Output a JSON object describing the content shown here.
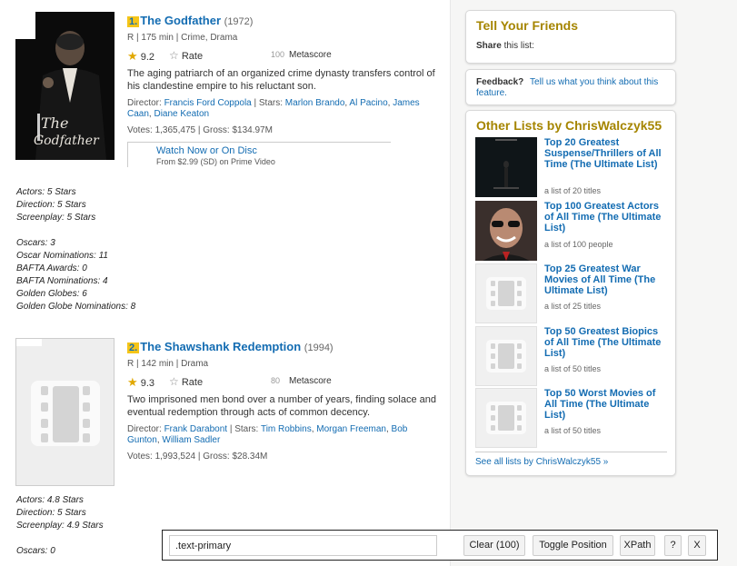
{
  "items": [
    {
      "rank": "1.",
      "title": "The Godfather",
      "year": "(1972)",
      "meta": "R | 175 min | Crime, Drama",
      "rating": "9.2",
      "rate_label": "Rate",
      "metascore": "100",
      "metascore_label": "Metascore",
      "description": "The aging patriarch of an organized crime dynasty transfers control of his clandestine empire to his reluctant son.",
      "director_label": "Director:",
      "director": "Francis Ford Coppola",
      "stars_label": "| Stars:",
      "stars": [
        "Marlon Brando",
        "Al Pacino",
        "James Caan",
        "Diane Keaton"
      ],
      "votes": "Votes: 1,365,475 | Gross: $134.97M",
      "watch_link": "Watch Now or On Disc",
      "watch_sub": "From $2.99 (SD) on Prime Video",
      "notes": [
        "Actors: 5 Stars",
        "Direction: 5 Stars",
        "Screenplay: 5 Stars",
        "",
        "Oscars: 3",
        "Oscar Nominations: 11",
        "BAFTA Awards: 0",
        "BAFTA Nominations: 4",
        "Golden Globes: 6",
        "Golden Globe Nominations: 8"
      ]
    },
    {
      "rank": "2.",
      "title": "The Shawshank Redemption",
      "year": "(1994)",
      "meta": "R | 142 min | Drama",
      "rating": "9.3",
      "rate_label": "Rate",
      "metascore": "80",
      "metascore_label": "Metascore",
      "description": "Two imprisoned men bond over a number of years, finding solace and eventual redemption through acts of common decency.",
      "director_label": "Director:",
      "director": "Frank Darabont",
      "stars_label": "| Stars:",
      "stars": [
        "Tim Robbins",
        "Morgan Freeman",
        "Bob Gunton",
        "William Sadler"
      ],
      "votes": "Votes: 1,993,524 | Gross: $28.34M",
      "notes": [
        "Actors: 4.8 Stars",
        "Direction: 5 Stars",
        "Screenplay: 4.9 Stars",
        "",
        "Oscars: 0"
      ]
    }
  ],
  "sidebar": {
    "friends": {
      "title": "Tell Your Friends",
      "share_bold": "Share",
      "share_rest": " this list:"
    },
    "feedback": {
      "bold": "Feedback?",
      "link": "Tell us what you think about this feature."
    },
    "other_lists": {
      "title": "Other Lists by ChrisWalczyk55",
      "entries": [
        {
          "title": "Top 20 Greatest Suspense/Thrillers of All Time (The Ultimate List)",
          "sub": "a list of 20 titles"
        },
        {
          "title": "Top 100 Greatest Actors of All Time (The Ultimate List)",
          "sub": "a list of 100 people"
        },
        {
          "title": "Top 25 Greatest War Movies of All Time (The Ultimate List)",
          "sub": "a list of 25 titles"
        },
        {
          "title": "Top 50 Greatest Biopics of All Time (The Ultimate List)",
          "sub": "a list of 50 titles"
        },
        {
          "title": "Top 50 Worst Movies of All Time (The Ultimate List)",
          "sub": "a list of 50 titles"
        }
      ],
      "see_all": "See all lists by ChrisWalczyk55 »"
    }
  },
  "toolbar": {
    "selector_value": ".text-primary",
    "clear_label": "Clear (100)",
    "toggle_label": "Toggle Position",
    "xpath_label": "XPath",
    "help_label": "?",
    "close_label": "X"
  },
  "colors": {
    "link": "#136cb2",
    "rank_highlight": "#f5c518",
    "sidebar_heading": "#a58500",
    "star": "#e1a800"
  }
}
